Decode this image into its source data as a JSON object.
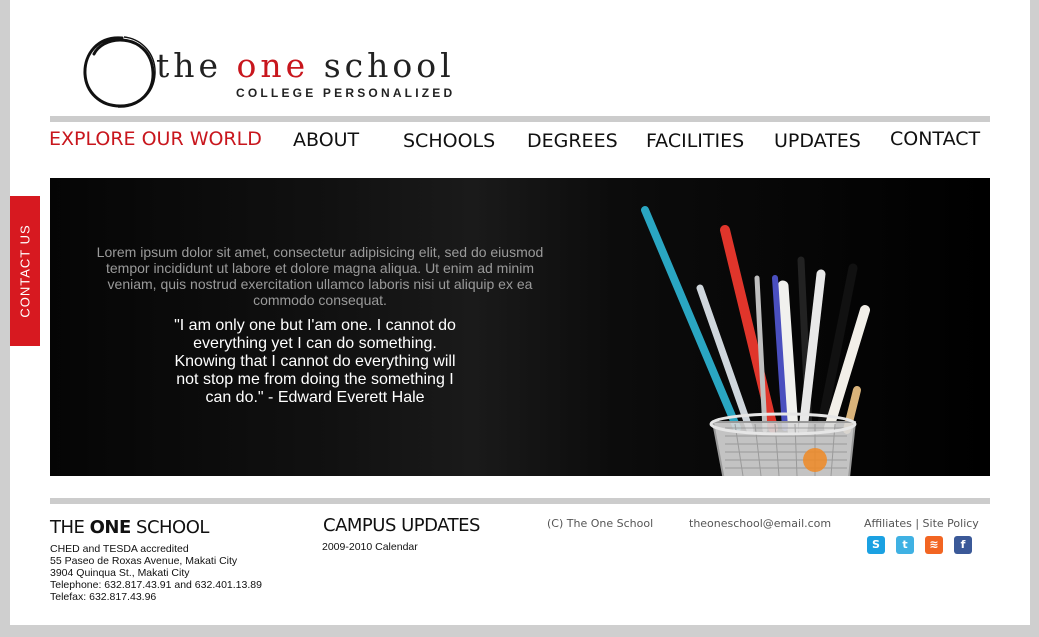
{
  "logo": {
    "title_pre": "the ",
    "title_accent": "one",
    "title_post": " school",
    "subtitle": "COLLEGE PERSONALIZED"
  },
  "nav": {
    "items": [
      {
        "label": "EXPLORE OUR WORLD",
        "active": true
      },
      {
        "label": "ABOUT"
      },
      {
        "label": "SCHOOLS"
      },
      {
        "label": "DEGREES"
      },
      {
        "label": "FACILITIES"
      },
      {
        "label": "UPDATES"
      },
      {
        "label": "CONTACT"
      }
    ]
  },
  "contact_tab": {
    "label": "CONTACT US"
  },
  "hero": {
    "lorem": "Lorem ipsum dolor sit amet, consectetur adipisicing elit, sed do eiusmod tempor incididunt ut labore et dolore magna aliqua. Ut enim ad minim veniam, quis nostrud exercitation ullamco laboris nisi ut aliquip ex ea commodo consequat.",
    "quote": "\"I am only one but I'am one. I cannot do everything yet I can do something. Knowing that I cannot do everything will not stop me from doing the something I can do.\" - Edward Everett Hale"
  },
  "footer": {
    "school_title_pre": "THE ",
    "school_title_bold": "ONE",
    "school_title_post": " SCHOOL",
    "school_lines": [
      "CHED and TESDA accredited",
      "55 Paseo de Roxas Avenue, Makati City",
      "3904 Quinqua St., Makati City",
      "Telephone: 632.817.43.91 and 632.401.13.89",
      "Telefax: 632.817.43.96"
    ],
    "campus_title": "CAMPUS UPDATES",
    "campus_item": "2009-2010 Calendar",
    "copyright": "(C) The One School",
    "email": "theoneschool@email.com",
    "affiliates": "Affiliates",
    "separator": "|",
    "site_policy": "Site Policy",
    "social": [
      {
        "icon": "skype-icon",
        "glyph": "S",
        "color": "#1ba1e2"
      },
      {
        "icon": "twitter-icon",
        "glyph": "t",
        "color": "#3fb1e3"
      },
      {
        "icon": "rss-icon",
        "glyph": "≋",
        "color": "#f26522"
      },
      {
        "icon": "facebook-icon",
        "glyph": "f",
        "color": "#3b5998"
      }
    ]
  },
  "colors": {
    "accent": "#c8161d",
    "background": "#cfcfcf",
    "rule": "#cccccc"
  }
}
